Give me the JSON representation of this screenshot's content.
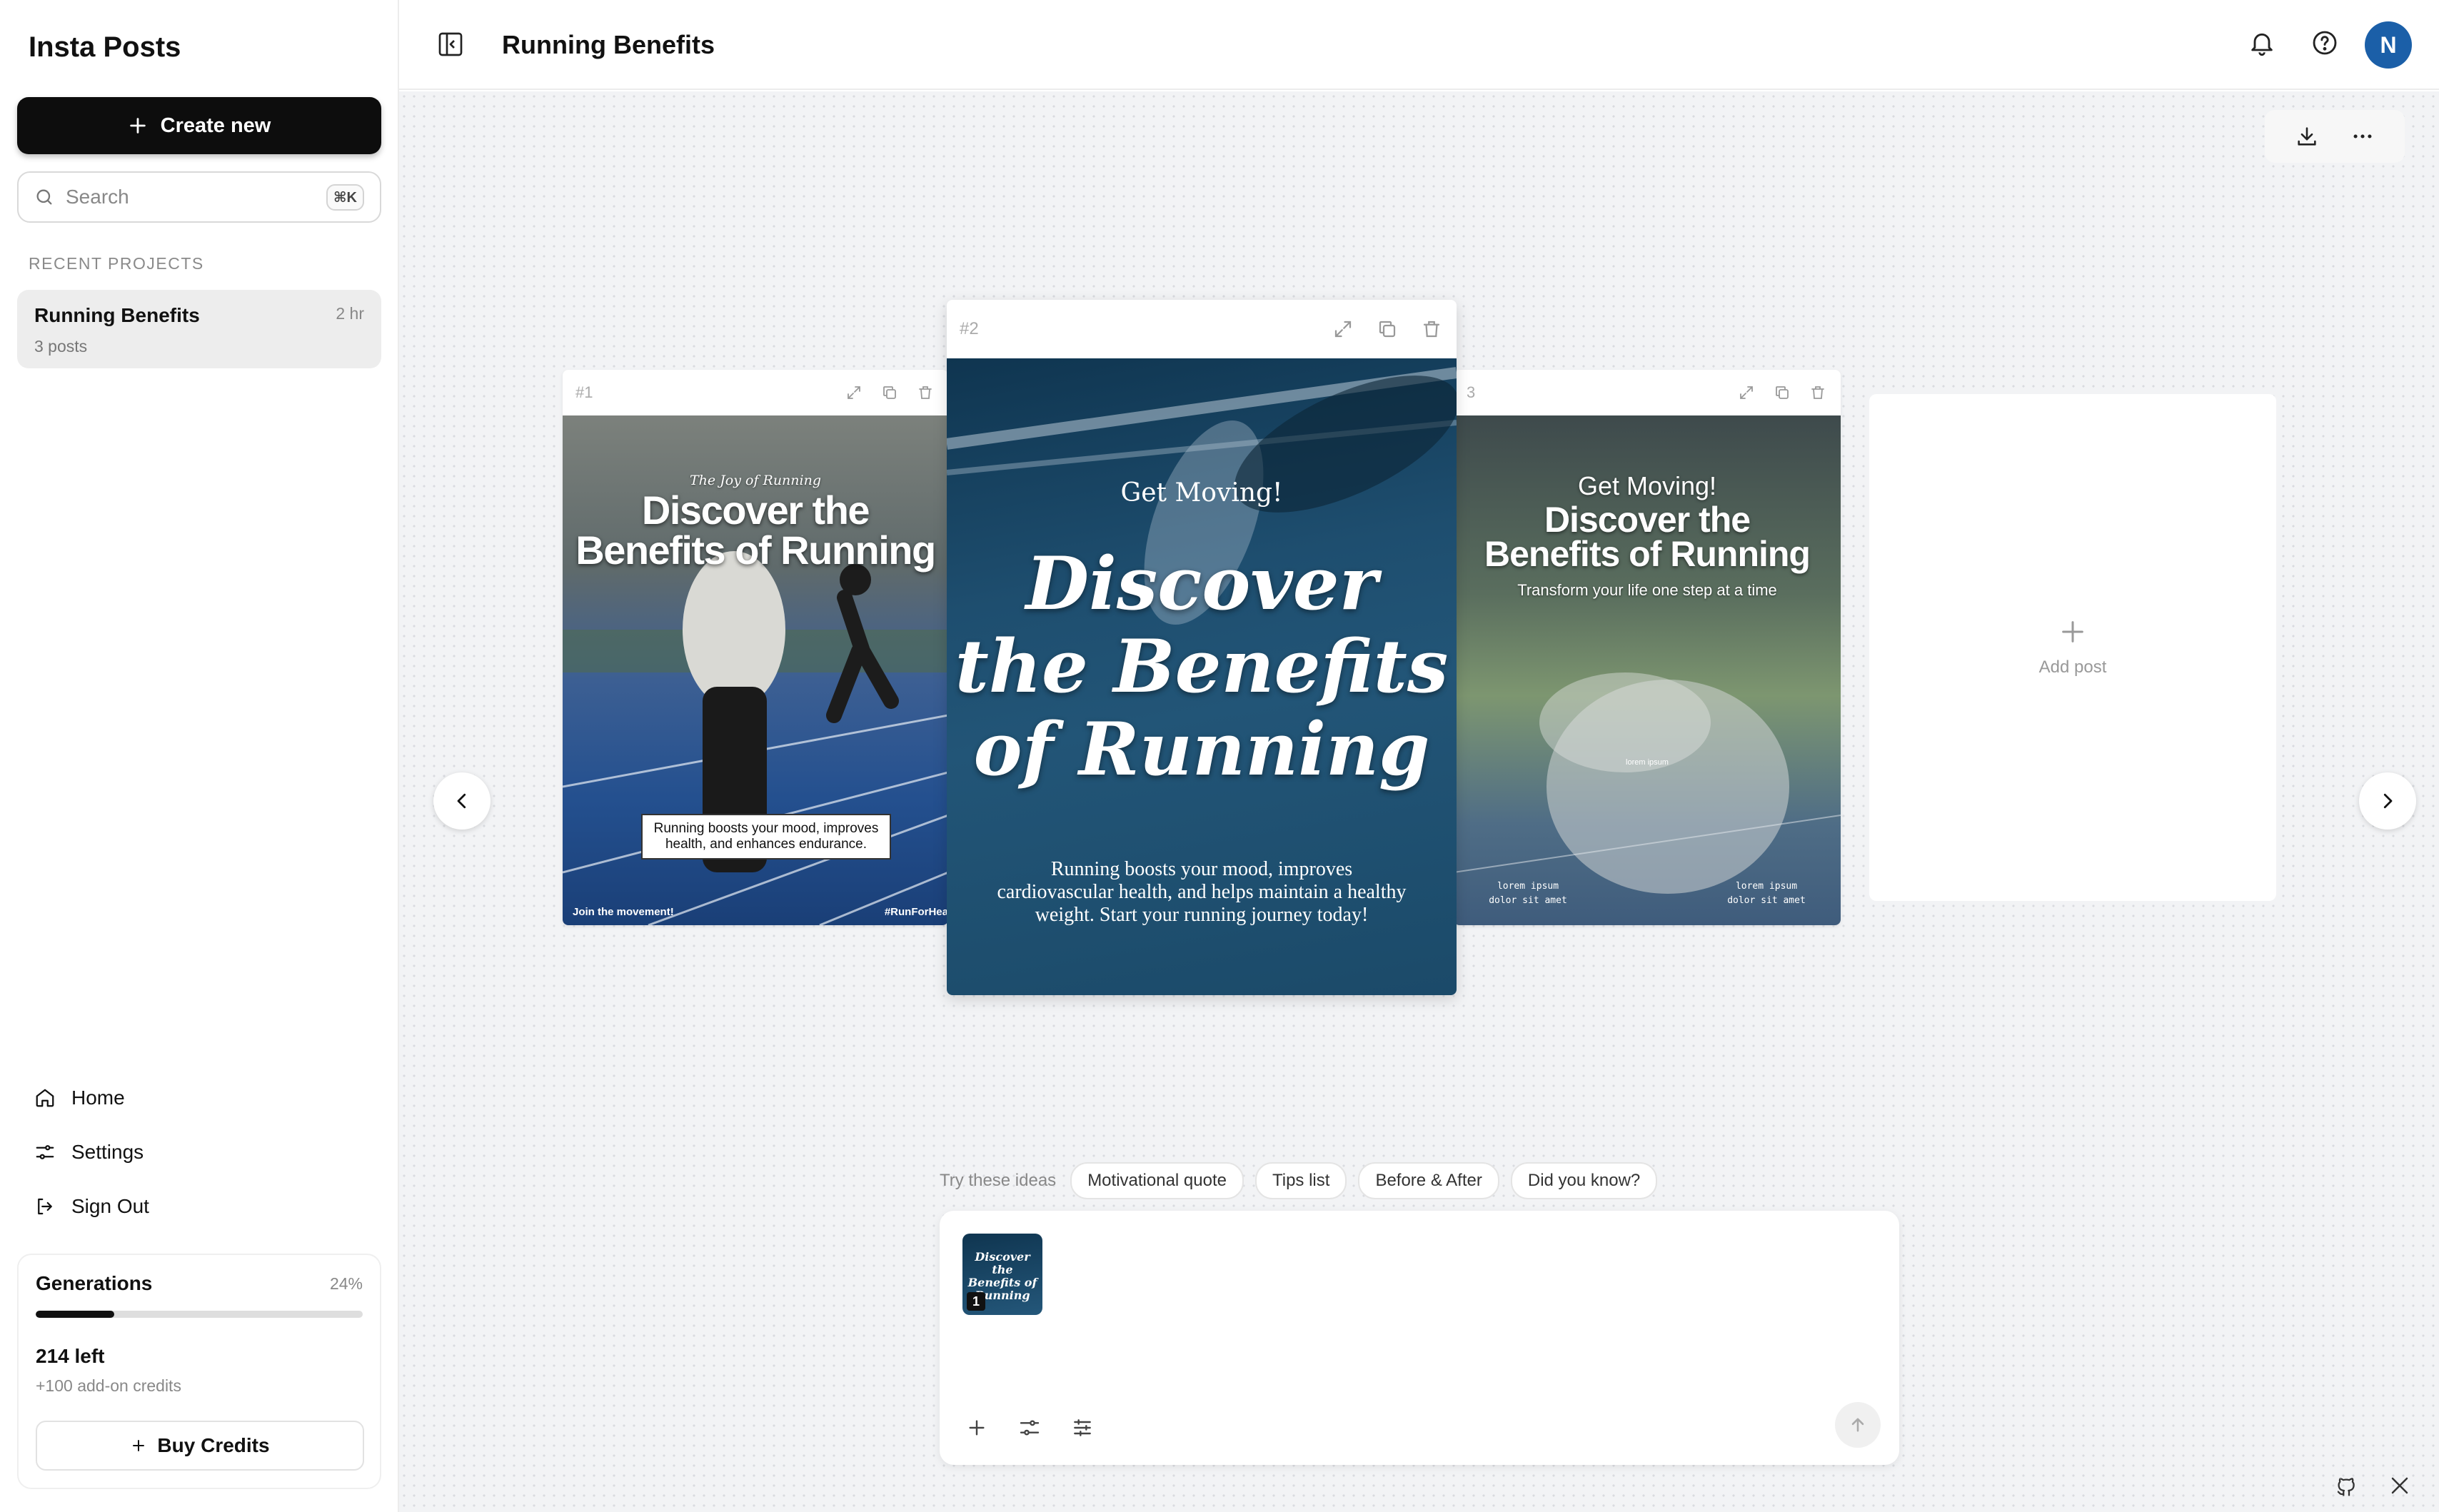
{
  "app": {
    "title": "Insta Posts"
  },
  "sidebar": {
    "create_label": "Create new",
    "search": {
      "placeholder": "Search",
      "shortcut": "⌘K"
    },
    "recent_label": "RECENT PROJECTS",
    "project": {
      "title": "Running Benefits",
      "time": "2 hr",
      "subtitle": "3 posts"
    },
    "nav": [
      {
        "label": "Home",
        "icon": "home-icon"
      },
      {
        "label": "Settings",
        "icon": "sliders-icon"
      },
      {
        "label": "Sign Out",
        "icon": "sign-out-icon"
      }
    ],
    "generations": {
      "title": "Generations",
      "percent_label": "24%",
      "progress": 0.24,
      "left": "214 left",
      "addon": "+100 add-on credits",
      "buy_label": "Buy Credits"
    }
  },
  "header": {
    "title": "Running Benefits",
    "avatar_initial": "N",
    "avatar_color": "#1b5fa8"
  },
  "posts": [
    {
      "number": "#1",
      "kicker": "The Joy of Running",
      "headline_1": "Discover the",
      "headline_2": "Benefits of Running",
      "caption": "Running boosts your mood, improves health, and enhances endurance.",
      "footer_left": "Join the movement!",
      "footer_right": "#RunForHea"
    },
    {
      "number": "#2",
      "kicker": "Get Moving!",
      "headline_1": "Discover",
      "headline_2": "the Benefits",
      "headline_3": "of Running",
      "body": "Running boosts your mood, improves cardiovascular health, and helps maintain a healthy weight. Start your running journey today!"
    },
    {
      "number": "3",
      "kicker": "Get Moving!",
      "headline_1": "Discover the",
      "headline_2": "Benefits of Running",
      "sub": "Transform your life one step at a time",
      "tiny": "lorem ipsum",
      "note_left": "lorem ipsum dolor sit amet",
      "note_right": "lorem ipsum dolor sit amet"
    }
  ],
  "add_post_label": "Add post",
  "ideas": {
    "label": "Try these ideas",
    "chips": [
      "Motivational quote",
      "Tips list",
      "Before & After",
      "Did you know?"
    ]
  },
  "composer": {
    "thumb_text": "Discover the Benefits of Running",
    "thumb_badge": "1"
  },
  "colors": {
    "accent": "#1b5fa8",
    "canvas": "#f2f3f5",
    "post_blue": "#1d4b6b"
  }
}
